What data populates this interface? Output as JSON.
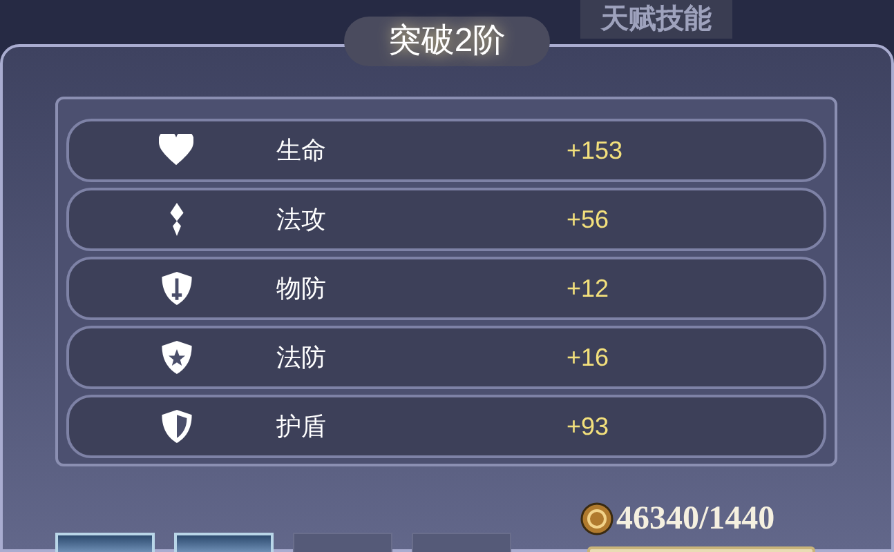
{
  "header_tab": {
    "label": "天赋技能"
  },
  "title": "突破2阶",
  "stats": [
    {
      "kind": "heart",
      "label": "生命",
      "value": "+153"
    },
    {
      "kind": "gem",
      "label": "法攻",
      "value": "+56"
    },
    {
      "kind": "sword-shield",
      "label": "物防",
      "value": "+12"
    },
    {
      "kind": "star-shield",
      "label": "法防",
      "value": "+16"
    },
    {
      "kind": "shield",
      "label": "护盾",
      "value": "+93"
    }
  ],
  "cost": {
    "amount": "46340/1440"
  },
  "slots": [
    {
      "kind": "filled"
    },
    {
      "kind": "filled"
    },
    {
      "kind": "empty"
    },
    {
      "kind": "empty"
    }
  ]
}
